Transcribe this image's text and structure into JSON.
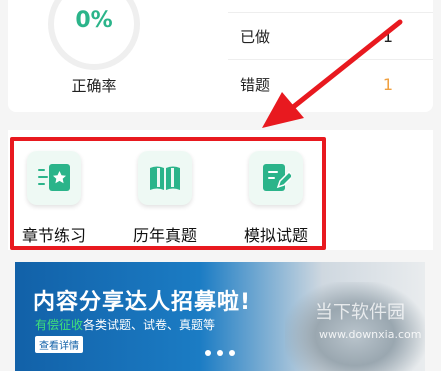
{
  "stats": {
    "accuracy_value": "0%",
    "accuracy_label": "正确率",
    "done_label": "已做",
    "done_value": "1",
    "wrong_label": "错题",
    "wrong_value": "1"
  },
  "menu": {
    "items": [
      {
        "label": "章节练习",
        "icon": "chapter-list-icon"
      },
      {
        "label": "历年真题",
        "icon": "open-book-icon"
      },
      {
        "label": "模拟试题",
        "icon": "document-edit-icon"
      }
    ]
  },
  "banner": {
    "title": "内容分享达人招募啦!",
    "sub_highlight": "有偿征收",
    "sub_rest": "各类试题、试卷、真题等",
    "button": "查看详情",
    "watermark": "当下软件园",
    "watermark_url": "www.downxia.com"
  },
  "colors": {
    "accent": "#2bb48a",
    "warning": "#f0a040",
    "highlight": "#e8191f"
  }
}
